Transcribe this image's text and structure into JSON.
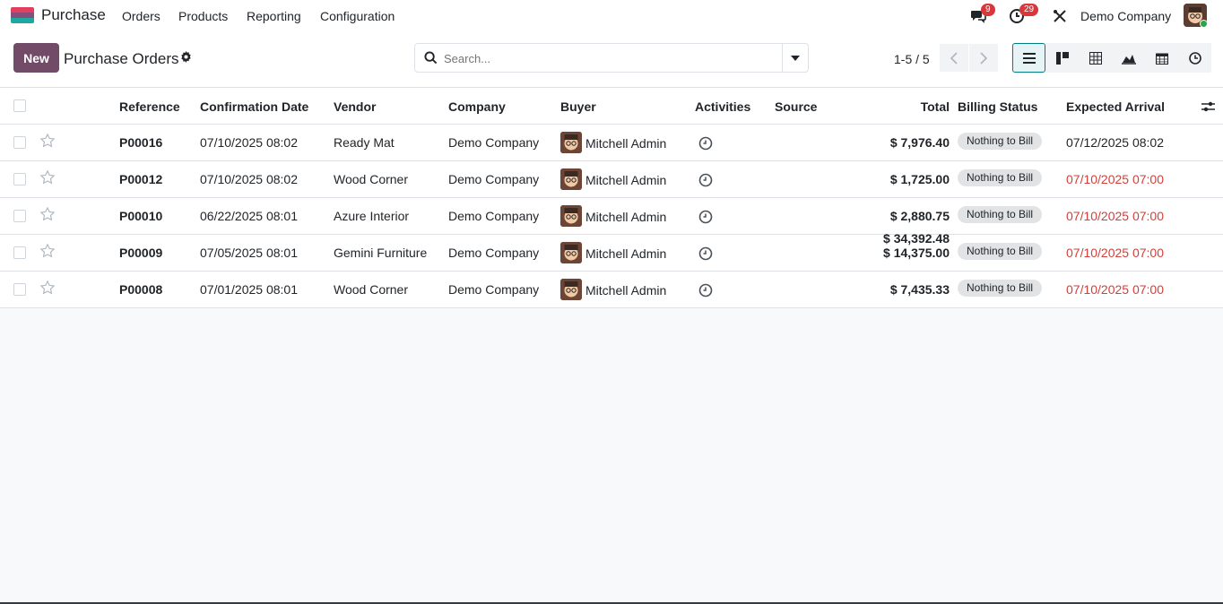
{
  "app": {
    "name": "Purchase"
  },
  "menu": [
    "Orders",
    "Products",
    "Reporting",
    "Configuration"
  ],
  "systray": {
    "messages_badge": "9",
    "activities_badge": "29",
    "company": "Demo Company"
  },
  "control": {
    "new_label": "New",
    "title": "Purchase Orders",
    "search_placeholder": "Search...",
    "pager": "1-5 / 5"
  },
  "columns": [
    "Reference",
    "Confirmation Date",
    "Vendor",
    "Company",
    "Buyer",
    "Activities",
    "Source",
    "Total",
    "Billing Status",
    "Expected Arrival"
  ],
  "rows": [
    {
      "reference": "P00016",
      "confirmation_date": "07/10/2025 08:02",
      "vendor": "Ready Mat",
      "company": "Demo Company",
      "buyer": "Mitchell Admin",
      "total": "$ 7,976.40",
      "billing_status": "Nothing to Bill",
      "expected_arrival": "07/12/2025 08:02",
      "late": false
    },
    {
      "reference": "P00012",
      "confirmation_date": "07/10/2025 08:02",
      "vendor": "Wood Corner",
      "company": "Demo Company",
      "buyer": "Mitchell Admin",
      "total": "$ 1,725.00",
      "billing_status": "Nothing to Bill",
      "expected_arrival": "07/10/2025 07:00",
      "late": true
    },
    {
      "reference": "P00010",
      "confirmation_date": "06/22/2025 08:01",
      "vendor": "Azure Interior",
      "company": "Demo Company",
      "buyer": "Mitchell Admin",
      "total": "$ 2,880.75",
      "billing_status": "Nothing to Bill",
      "expected_arrival": "07/10/2025 07:00",
      "late": true
    },
    {
      "reference": "P00009",
      "confirmation_date": "07/05/2025 08:01",
      "vendor": "Gemini Furniture",
      "company": "Demo Company",
      "buyer": "Mitchell Admin",
      "total": "$ 14,375.00",
      "billing_status": "Nothing to Bill",
      "expected_arrival": "07/10/2025 07:00",
      "late": true
    },
    {
      "reference": "P00008",
      "confirmation_date": "07/01/2025 08:01",
      "vendor": "Wood Corner",
      "company": "Demo Company",
      "buyer": "Mitchell Admin",
      "total": "$ 7,435.33",
      "billing_status": "Nothing to Bill",
      "expected_arrival": "07/10/2025 07:00",
      "late": true
    }
  ],
  "grand_total": "$ 34,392.48",
  "colors": {
    "brand": "#714b67",
    "late": "#d23f3a",
    "active_view": "#017e84"
  }
}
